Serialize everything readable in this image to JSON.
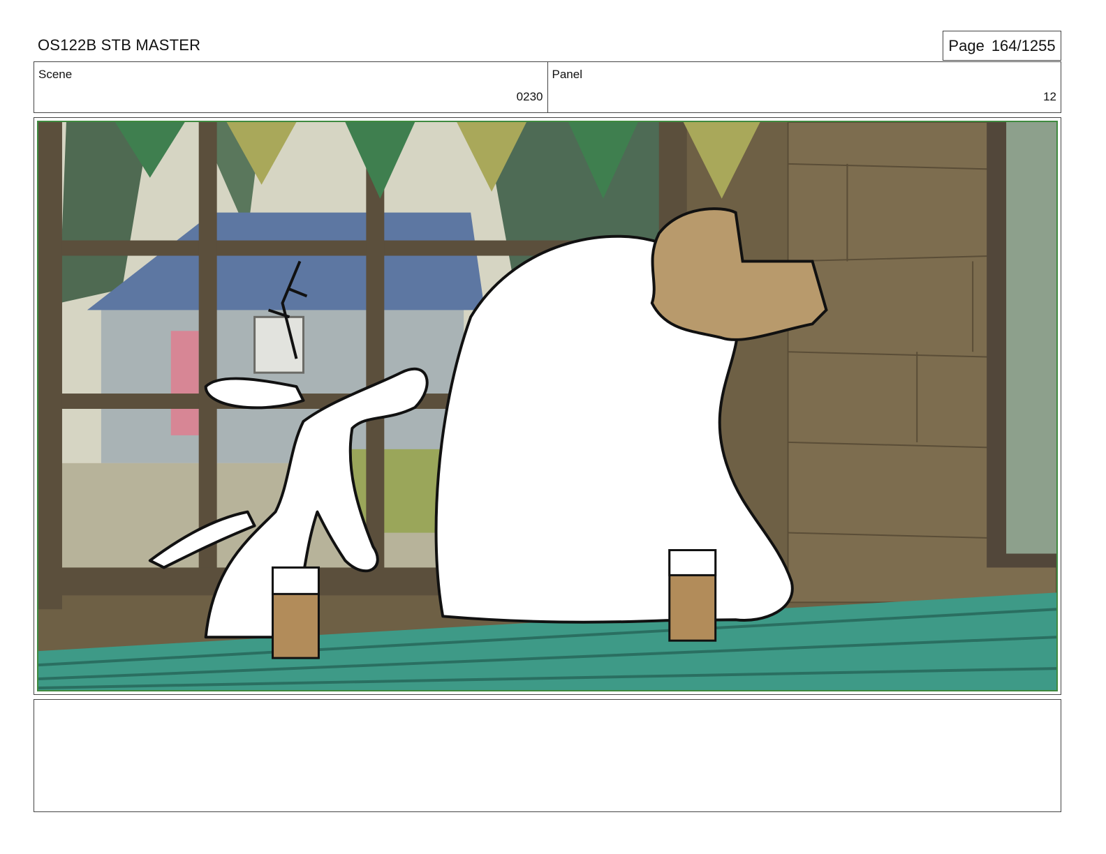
{
  "document": {
    "title": "OS122B STB MASTER",
    "page_label": "Page",
    "page_number": "164/1255"
  },
  "scene": {
    "label": "Scene",
    "value": "0230"
  },
  "panel": {
    "label": "Panel",
    "value": "12"
  },
  "frame": {
    "image": "storyboard-panel-illustration",
    "colors": {
      "wall": "#7a6a4c",
      "window_frame": "#5c5040",
      "sky": "#d8d6c4",
      "roof": "#5a73a0",
      "table": "#3e9a87",
      "bunting_green": "#3f7f4f",
      "bunting_yellow": "#a9a85a",
      "drink": "#b28c5a",
      "bear_face": "#b89a6c"
    }
  },
  "notes": {
    "text": ""
  }
}
